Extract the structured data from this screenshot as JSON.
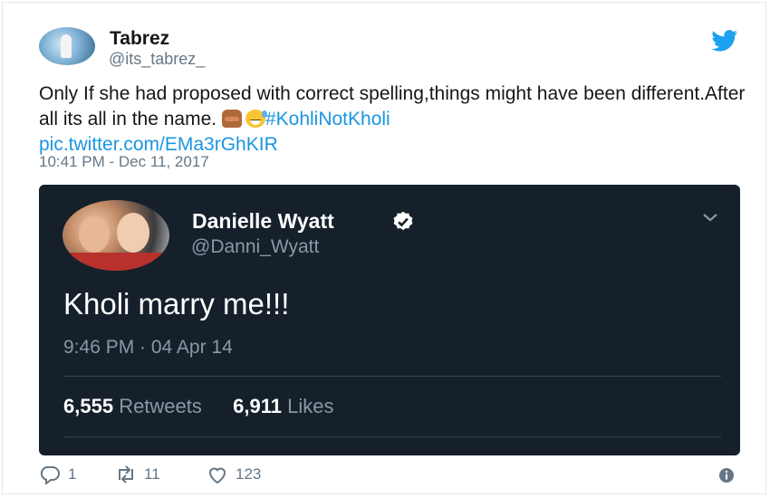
{
  "tweet": {
    "author_name": "Tabrez",
    "author_handle": "@its_tabrez_",
    "text_part1": "Only If she had proposed with correct spelling,things might have been different.After all its all in the name.",
    "hashtag": "#KohliNotKholi",
    "link": "pic.twitter.com/EMa3rGhKIR",
    "timestamp": "10:41 PM - Dec 11, 2017",
    "emojis": [
      "see-no-evil-monkey-emoji",
      "sweat-smile-emoji"
    ],
    "brand_icon": "twitter-bird-icon",
    "colors": {
      "brand": "#1da1f2",
      "link": "#1b95e0",
      "muted": "#657786"
    }
  },
  "quoted_tweet": {
    "author_name": "Danielle Wyatt",
    "author_handle": "@Danni_Wyatt",
    "verified_icon": "verified-badge-icon",
    "text": "Kholi marry me!!!",
    "timestamp": "9:46 PM · 04 Apr 14",
    "retweets_count": "6,555",
    "retweets_label": "Retweets",
    "likes_count": "6,911",
    "likes_label": "Likes",
    "colors": {
      "background": "#15202b",
      "text": "#ffffff",
      "muted": "#8899a6"
    }
  },
  "actions": {
    "reply_count": "1",
    "retweet_count": "11",
    "like_count": "123",
    "icons": [
      "reply-icon",
      "retweet-icon",
      "heart-icon",
      "info-icon"
    ]
  }
}
